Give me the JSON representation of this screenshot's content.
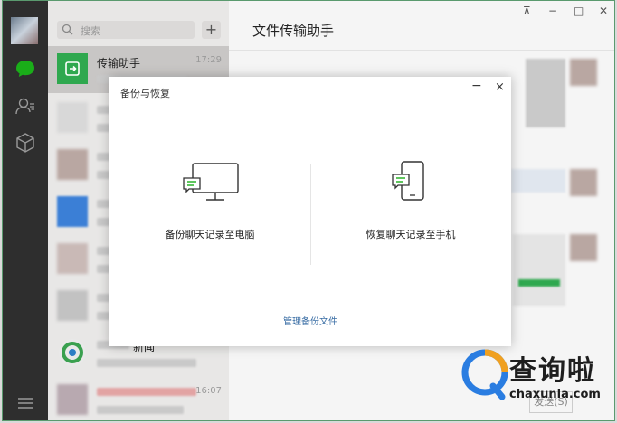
{
  "sidebar": {
    "icons": [
      "avatar",
      "chat-icon",
      "contacts-icon",
      "box-icon",
      "menu-icon"
    ]
  },
  "search": {
    "placeholder": "搜索",
    "add_label": "+"
  },
  "chats": [
    {
      "name": "传输助手",
      "time": "17:29",
      "active": true
    },
    {
      "name": "",
      "time": ""
    },
    {
      "name": "",
      "time": ""
    },
    {
      "name": "",
      "time": ""
    },
    {
      "name": "",
      "time": ""
    },
    {
      "name": "",
      "time": ""
    },
    {
      "name": "新闻",
      "time": ""
    },
    {
      "name": "",
      "time": "16:07"
    }
  ],
  "pane": {
    "title": "文件传输助手",
    "send_label": "发送(S)",
    "window_controls": {
      "pin": "⊼",
      "minimize": "−",
      "maximize": "□",
      "close": "✕"
    }
  },
  "dialog": {
    "title": "备份与恢复",
    "minimize": "−",
    "close": "×",
    "backup_label": "备份聊天记录至电脑",
    "restore_label": "恢复聊天记录至手机",
    "manage_label": "管理备份文件"
  },
  "watermark": {
    "text": "查询啦",
    "url": "chaxunla.com"
  },
  "colors": {
    "accent": "#1aad19",
    "rail": "#2e2e2e",
    "link": "#3a6ea5"
  }
}
